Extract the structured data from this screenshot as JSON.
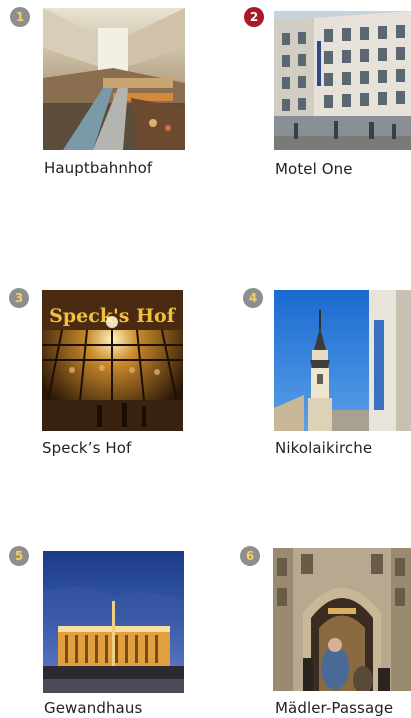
{
  "items": [
    {
      "number": "1",
      "name": "Hauptbahnhof",
      "badge_color": "#8e8e8e",
      "badge_text_color": "#f2d060",
      "photo": "train-station-hall-photo"
    },
    {
      "number": "2",
      "name": "Motel One",
      "badge_color": "#a8192a",
      "badge_text_color": "#ffffff",
      "photo": "hotel-building-photo"
    },
    {
      "number": "3",
      "name": "Speck’s Hof",
      "badge_color": "#8e8e8e",
      "badge_text_color": "#f2d060",
      "photo": "arcade-entrance-photo",
      "photo_sign": "Speck's Hof"
    },
    {
      "number": "4",
      "name": "Nikolaikirche",
      "badge_color": "#8e8e8e",
      "badge_text_color": "#f2d060",
      "photo": "church-tower-photo"
    },
    {
      "number": "5",
      "name": "Gewandhaus",
      "badge_color": "#8e8e8e",
      "badge_text_color": "#f2d060",
      "photo": "concert-hall-photo"
    },
    {
      "number": "6",
      "name": "Mädler-Passage",
      "badge_color": "#8e8e8e",
      "badge_text_color": "#f2d060",
      "photo": "passage-entrance-photo"
    }
  ]
}
